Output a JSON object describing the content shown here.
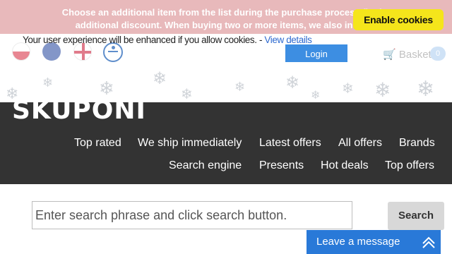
{
  "promo": {
    "line1": "Choose an additional item from the list during the purchase process (in the",
    "line2": "additional discount. When buying two or more items, we also include"
  },
  "cookie": {
    "text": "Your user experience will be enhanced if you allow cookies. - ",
    "link": "View details",
    "button": "Enable cookies"
  },
  "header": {
    "login": "Login",
    "basket": "Basket",
    "basket_count": "0",
    "languages": [
      "pl",
      "eu",
      "en"
    ],
    "accessibility_icon": "accessibility-icon"
  },
  "logo": "SKUPONI",
  "nav": {
    "row1": [
      "Top rated",
      "We ship immediately",
      "Latest offers",
      "All offers",
      "Brands"
    ],
    "row2": [
      "Search engine",
      "Presents",
      "Hot deals",
      "Top offers"
    ]
  },
  "search": {
    "placeholder": "Enter search phrase and click search button.",
    "button": "Search"
  },
  "chat": {
    "label": "Leave a message",
    "icon": "maximize-icon"
  },
  "colors": {
    "accent": "#3d8ee2",
    "cookie_button": "#f5e51b",
    "nav_background": "#333333",
    "chat": "#2979d8"
  }
}
